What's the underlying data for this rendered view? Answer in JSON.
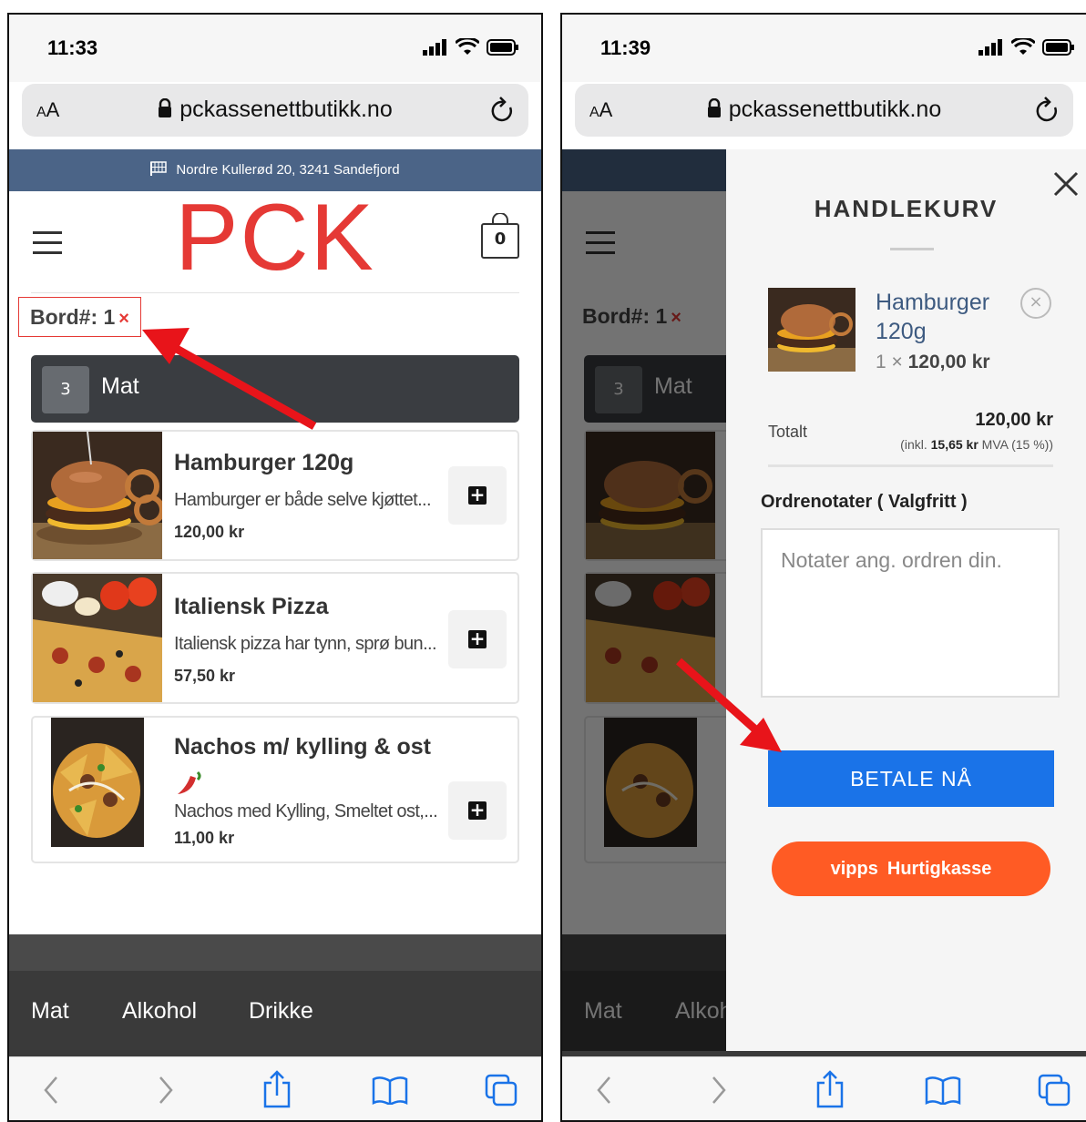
{
  "status_bar": {
    "time_left": "11:33",
    "time_right": "11:39"
  },
  "browser": {
    "aa": "A",
    "aa_small": "A",
    "url": "pckassenettbutikk.no"
  },
  "store": {
    "address": "Nordre Kullerød 20, 3241 Sandefjord",
    "logo": "PCK",
    "cart_count": "0",
    "table_label": "Bord#: 1",
    "table_remove": "×"
  },
  "category": {
    "count": "3",
    "name": "Mat"
  },
  "products": [
    {
      "name": "Hamburger 120g",
      "desc": "Hamburger er både selve kjøttet...",
      "price": "120,00 kr"
    },
    {
      "name": "Italiensk Pizza",
      "desc": "Italiensk pizza har tynn, sprø bun...",
      "price": "57,50 kr"
    },
    {
      "name": "Nachos m/ kylling & ost",
      "desc": "Nachos med Kylling, Smeltet ost,...",
      "price": "11,00 kr"
    }
  ],
  "bottom_nav": [
    "Mat",
    "Alkohol",
    "Drikke"
  ],
  "cart": {
    "title": "HANDLEKURV",
    "item_name": "Hamburger 120g",
    "item_qty": "1 ×",
    "item_price": "120,00 kr",
    "remove": "×",
    "total_label": "Totalt",
    "total_amount": "120,00 kr",
    "vat_prefix": "(inkl. ",
    "vat_amount": "15,65 kr",
    "vat_suffix": " MVA (15 %))",
    "notes_label": "Ordrenotater ( Valgfritt )",
    "notes_placeholder": "Notater ang. ordren din.",
    "pay_button": "BETALE NÅ",
    "vipps_logo": "vipps",
    "vipps_label": "Hurtigkasse"
  },
  "colors": {
    "brand_red": "#e53935",
    "banner": "#4b6487",
    "pay_blue": "#1a73e8",
    "vipps_orange": "#ff5b24",
    "dark_bar": "#3a3d41"
  }
}
